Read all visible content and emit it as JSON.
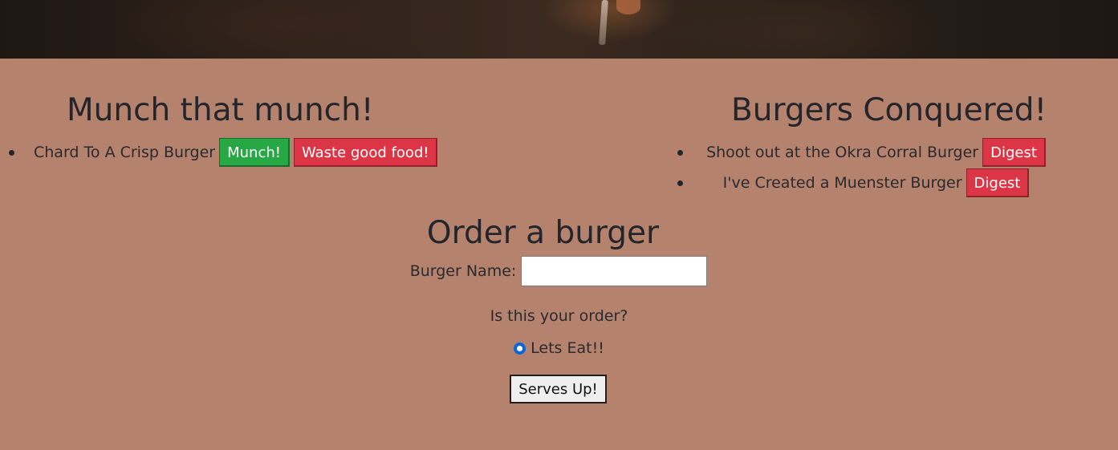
{
  "left_panel": {
    "heading": "Munch that munch!",
    "items": [
      {
        "name": "Chard To A Crisp Burger",
        "eat_label": "Munch!",
        "waste_label": "Waste good food!"
      }
    ]
  },
  "right_panel": {
    "heading": "Burgers Conquered!",
    "items": [
      {
        "name": "Shoot out at the Okra Corral Burger",
        "action_label": "Digest"
      },
      {
        "name": "I've Created a Muenster Burger",
        "action_label": "Digest"
      }
    ]
  },
  "order_form": {
    "heading": "Order a burger",
    "name_label": "Burger Name:",
    "name_value": "",
    "question": "Is this your order?",
    "radio_label": "Lets Eat!!",
    "radio_checked": true,
    "submit_label": "Serves Up!"
  },
  "colors": {
    "page_background": "#b5826e",
    "green_button": "#28a745",
    "red_button": "#dc3545",
    "radio_accent": "#0a66d9"
  }
}
